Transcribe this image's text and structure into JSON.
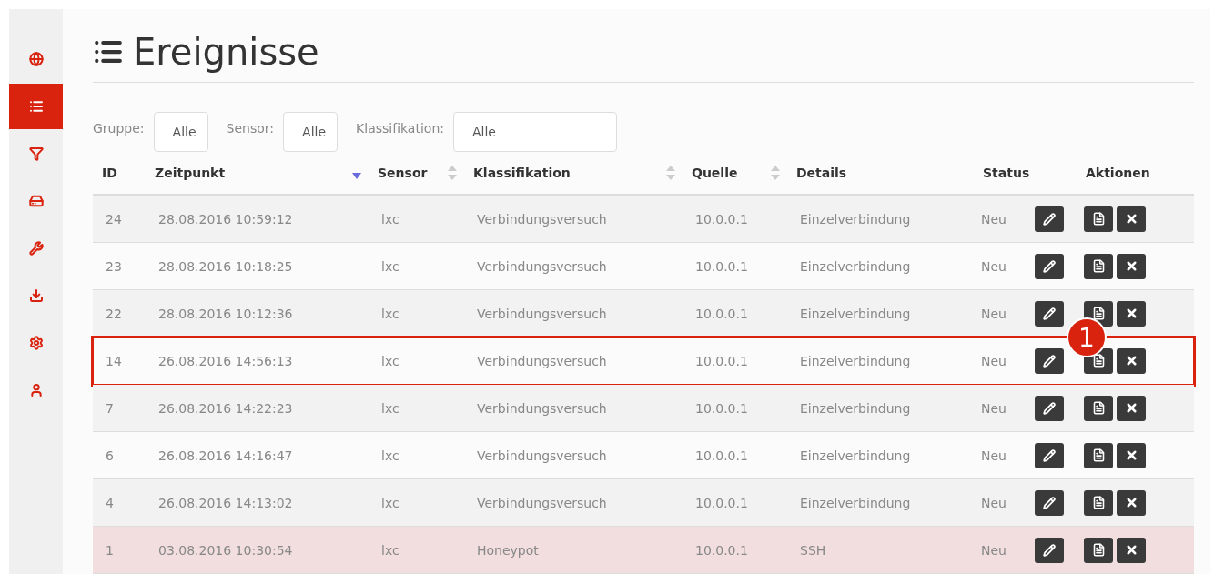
{
  "sidebar": {
    "items": [
      {
        "kind": "globe",
        "selected": false
      },
      {
        "kind": "list",
        "selected": true
      },
      {
        "kind": "filter",
        "selected": false
      },
      {
        "kind": "drive",
        "selected": false
      },
      {
        "kind": "wrench",
        "selected": false
      },
      {
        "kind": "download",
        "selected": false
      },
      {
        "kind": "gear",
        "selected": false
      },
      {
        "kind": "user",
        "selected": false
      }
    ]
  },
  "page": {
    "title": "Ereignisse"
  },
  "filters": [
    {
      "label": "Gruppe:",
      "value": "Alle",
      "wide": false
    },
    {
      "label": "Sensor:",
      "value": "Alle",
      "wide": false
    },
    {
      "label": "Klassifikation:",
      "value": "Alle",
      "wide": true
    }
  ],
  "table": {
    "columns": [
      {
        "label": "ID",
        "sortable": false,
        "sorted": false
      },
      {
        "label": "Zeitpunkt",
        "sortable": true,
        "sorted": true
      },
      {
        "label": "Sensor",
        "sortable": true,
        "sorted": false
      },
      {
        "label": "Klassifikation",
        "sortable": true,
        "sorted": false
      },
      {
        "label": "Quelle",
        "sortable": true,
        "sorted": false
      },
      {
        "label": "Details",
        "sortable": false,
        "sorted": false
      },
      {
        "label": "Status",
        "sortable": false,
        "sorted": false
      },
      {
        "label": "Aktionen",
        "sortable": false,
        "sorted": false
      }
    ],
    "rows": [
      {
        "cells": [
          "24",
          "28.08.2016 10:59:12",
          "lxc",
          "Verbindungsversuch",
          "10.0.0.1",
          "Einzelverbindung",
          "Neu"
        ],
        "kind": "normal",
        "outlined": false
      },
      {
        "cells": [
          "23",
          "28.08.2016 10:18:25",
          "lxc",
          "Verbindungsversuch",
          "10.0.0.1",
          "Einzelverbindung",
          "Neu"
        ],
        "kind": "normal",
        "outlined": false
      },
      {
        "cells": [
          "22",
          "28.08.2016 10:12:36",
          "lxc",
          "Verbindungsversuch",
          "10.0.0.1",
          "Einzelverbindung",
          "Neu"
        ],
        "kind": "normal",
        "outlined": false
      },
      {
        "cells": [
          "14",
          "26.08.2016 14:56:13",
          "lxc",
          "Verbindungsversuch",
          "10.0.0.1",
          "Einzelverbindung",
          "Neu"
        ],
        "kind": "normal",
        "outlined": true,
        "callout": "1"
      },
      {
        "cells": [
          "7",
          "26.08.2016 14:22:23",
          "lxc",
          "Verbindungsversuch",
          "10.0.0.1",
          "Einzelverbindung",
          "Neu"
        ],
        "kind": "normal",
        "outlined": false
      },
      {
        "cells": [
          "6",
          "26.08.2016 14:16:47",
          "lxc",
          "Verbindungsversuch",
          "10.0.0.1",
          "Einzelverbindung",
          "Neu"
        ],
        "kind": "normal",
        "outlined": false
      },
      {
        "cells": [
          "4",
          "26.08.2016 14:13:02",
          "lxc",
          "Verbindungsversuch",
          "10.0.0.1",
          "Einzelverbindung",
          "Neu"
        ],
        "kind": "normal",
        "outlined": false
      },
      {
        "cells": [
          "1",
          "03.08.2016 10:30:54",
          "lxc",
          "Honeypot",
          "10.0.0.1",
          "SSH",
          "Neu"
        ],
        "kind": "alert",
        "outlined": false
      }
    ]
  }
}
